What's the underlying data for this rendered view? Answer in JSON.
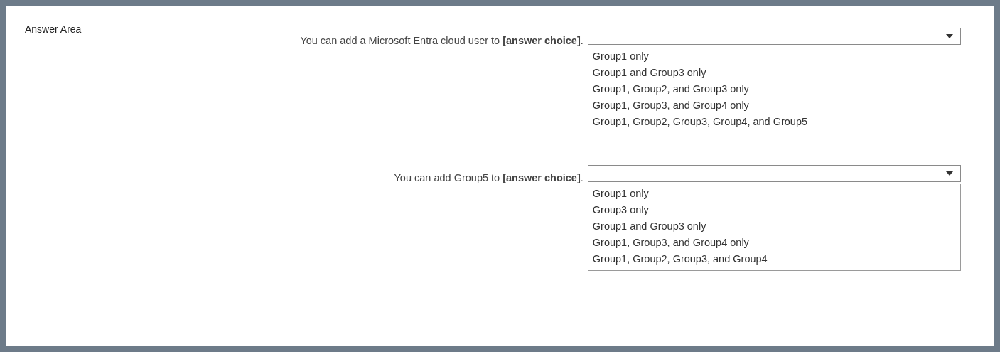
{
  "title": "Answer Area",
  "questions": [
    {
      "statement": "You can add a Microsoft Entra cloud user to **[answer choice]**.",
      "options": [
        "Group1 only",
        "Group1 and Group3 only",
        "Group1, Group2, and Group3 only",
        "Group1, Group3, and Group4 only",
        "Group1, Group2, Group3, Group4, and Group5"
      ]
    },
    {
      "statement": "You can add Group5 to **[answer choice]**.",
      "options": [
        "Group1 only",
        "Group3 only",
        "Group1 and Group3 only",
        "Group1, Group3, and Group4 only",
        "Group1, Group2, Group3, and Group4"
      ]
    }
  ]
}
